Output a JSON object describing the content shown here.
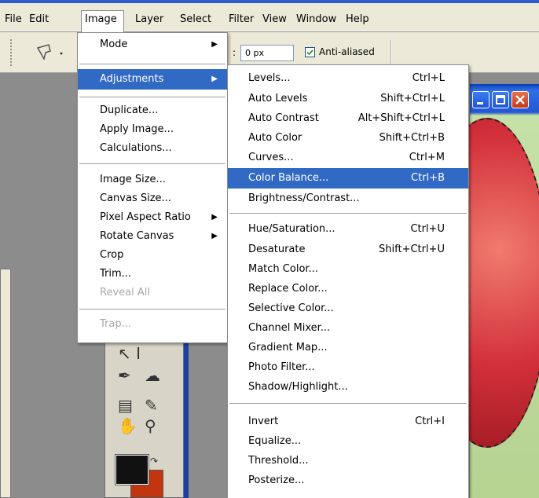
{
  "menubar": {
    "items": [
      {
        "label": "File"
      },
      {
        "label": "Edit"
      },
      {
        "label": "Image"
      },
      {
        "label": "Layer"
      },
      {
        "label": "Select"
      },
      {
        "label": "Filter"
      },
      {
        "label": "View"
      },
      {
        "label": "Window"
      },
      {
        "label": "Help"
      }
    ]
  },
  "options_bar": {
    "feather_value": "0 px",
    "anti_aliased_label": "Anti-aliased",
    "anti_aliased_checked": true
  },
  "image_menu": {
    "items": [
      {
        "label": "Mode",
        "submenu": true
      },
      {
        "label": "Adjustments",
        "submenu": true,
        "highlighted": true
      },
      {
        "label": "Duplicate..."
      },
      {
        "label": "Apply Image..."
      },
      {
        "label": "Calculations..."
      },
      {
        "label": "Image Size..."
      },
      {
        "label": "Canvas Size..."
      },
      {
        "label": "Pixel Aspect Ratio",
        "submenu": true
      },
      {
        "label": "Rotate Canvas",
        "submenu": true
      },
      {
        "label": "Crop"
      },
      {
        "label": "Trim..."
      },
      {
        "label": "Reveal All",
        "disabled": true
      },
      {
        "label": "Trap...",
        "disabled": true
      }
    ]
  },
  "adjustments_menu": {
    "items": [
      {
        "label": "Levels...",
        "shortcut": "Ctrl+L"
      },
      {
        "label": "Auto Levels",
        "shortcut": "Shift+Ctrl+L"
      },
      {
        "label": "Auto Contrast",
        "shortcut": "Alt+Shift+Ctrl+L"
      },
      {
        "label": "Auto Color",
        "shortcut": "Shift+Ctrl+B"
      },
      {
        "label": "Curves...",
        "shortcut": "Ctrl+M"
      },
      {
        "label": "Color Balance...",
        "shortcut": "Ctrl+B",
        "highlighted": true
      },
      {
        "label": "Brightness/Contrast...",
        "shortcut": ""
      },
      {
        "label": "Hue/Saturation...",
        "shortcut": "Ctrl+U"
      },
      {
        "label": "Desaturate",
        "shortcut": "Shift+Ctrl+U"
      },
      {
        "label": "Match Color...",
        "shortcut": ""
      },
      {
        "label": "Replace Color...",
        "shortcut": ""
      },
      {
        "label": "Selective Color...",
        "shortcut": ""
      },
      {
        "label": "Channel Mixer...",
        "shortcut": ""
      },
      {
        "label": "Gradient Map...",
        "shortcut": ""
      },
      {
        "label": "Photo Filter...",
        "shortcut": ""
      },
      {
        "label": "Shadow/Highlight...",
        "shortcut": ""
      },
      {
        "label": "Invert",
        "shortcut": "Ctrl+I"
      },
      {
        "label": "Equalize...",
        "shortcut": ""
      },
      {
        "label": "Threshold...",
        "shortcut": ""
      },
      {
        "label": "Posterize...",
        "shortcut": ""
      }
    ]
  },
  "tools": {
    "icons": [
      "move-crop-icon",
      "pen-icon",
      "custom-shape-icon",
      "notes-icon",
      "eyedropper-icon",
      "hand-icon",
      "zoom-icon"
    ]
  },
  "colors": {
    "highlight": "#316ac5",
    "foreground_swatch": "#111111",
    "background_swatch": "#c1360e"
  }
}
